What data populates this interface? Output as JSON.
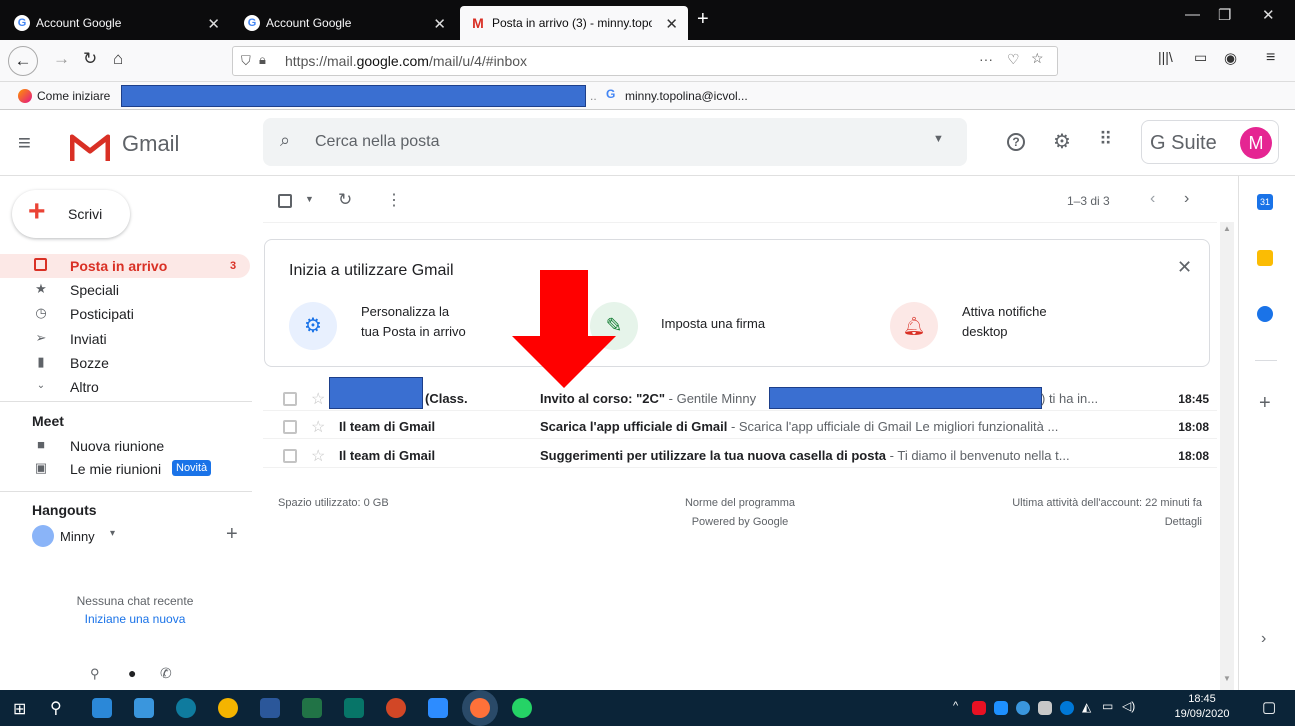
{
  "browser": {
    "tabs": [
      {
        "title": "Account Google"
      },
      {
        "title": "Account Google"
      },
      {
        "title": "Posta in arrivo (3) - minny.topo"
      }
    ],
    "url_prefix": "https://mail.",
    "url_domain": "google.com",
    "url_suffix": "/mail/u/4/#inbox",
    "bookmarks": [
      {
        "label": "Come iniziare"
      },
      {
        "label": "minny.topolina@icvol..."
      }
    ]
  },
  "gmail": {
    "logo": "Gmail",
    "search_placeholder": "Cerca nella posta",
    "gsuite": "G Suite",
    "avatar": "M",
    "compose": "Scrivi",
    "nav": [
      {
        "label": "Posta in arrivo",
        "count": "3",
        "icon": "inbox-icon"
      },
      {
        "label": "Speciali",
        "icon": "star-icon"
      },
      {
        "label": "Posticipati",
        "icon": "clock-icon"
      },
      {
        "label": "Inviati",
        "icon": "send-icon"
      },
      {
        "label": "Bozze",
        "icon": "draft-icon"
      },
      {
        "label": "Altro",
        "icon": "chevron-down-icon"
      }
    ],
    "meet": {
      "title": "Meet",
      "new_meeting": "Nuova riunione",
      "my_meetings": "Le mie riunioni",
      "badge": "Novità"
    },
    "hangouts": {
      "title": "Hangouts",
      "user": "Minny",
      "no_chat": "Nessuna chat recente",
      "start_new": "Iniziane una nuova"
    },
    "pagination": "1–3 di 3",
    "welcome": {
      "title": "Inizia a utilizzare Gmail",
      "items": [
        {
          "line1": "Personalizza la",
          "line2": "tua Posta in arrivo"
        },
        {
          "line1": "Imposta una firma",
          "line2": ""
        },
        {
          "line1": "Attiva notifiche",
          "line2": "desktop"
        }
      ]
    },
    "emails": [
      {
        "sender": "(Class.",
        "subject": "Invito al corso: \"2C\"",
        "snippet": " - Gentile Minny",
        "snippet_end": ") ti ha in...",
        "time": "18:45"
      },
      {
        "sender": "Il team di Gmail",
        "subject": "Scarica l'app ufficiale di Gmail",
        "snippet": " - Scarica l'app ufficiale di Gmail Le migliori funzionalità ...",
        "snippet_end": "",
        "time": "18:08"
      },
      {
        "sender": "Il team di Gmail",
        "subject": "Suggerimenti per utilizzare la tua nuova casella di posta",
        "snippet": " - Ti diamo il benvenuto nella t...",
        "snippet_end": "",
        "time": "18:08"
      }
    ],
    "footer": {
      "storage": "Spazio utilizzato: 0 GB",
      "policy": "Norme del programma",
      "powered": "Powered by Google",
      "activity": "Ultima attività dell'account: 22 minuti fa",
      "details": "Dettagli"
    }
  },
  "taskbar": {
    "time": "18:45",
    "date": "19/09/2020"
  },
  "colors": {
    "gmail_red": "#d93025",
    "annotation_arrow": "#ff0000",
    "redaction": "#3a6fd1",
    "taskbar": "#0b2438"
  }
}
